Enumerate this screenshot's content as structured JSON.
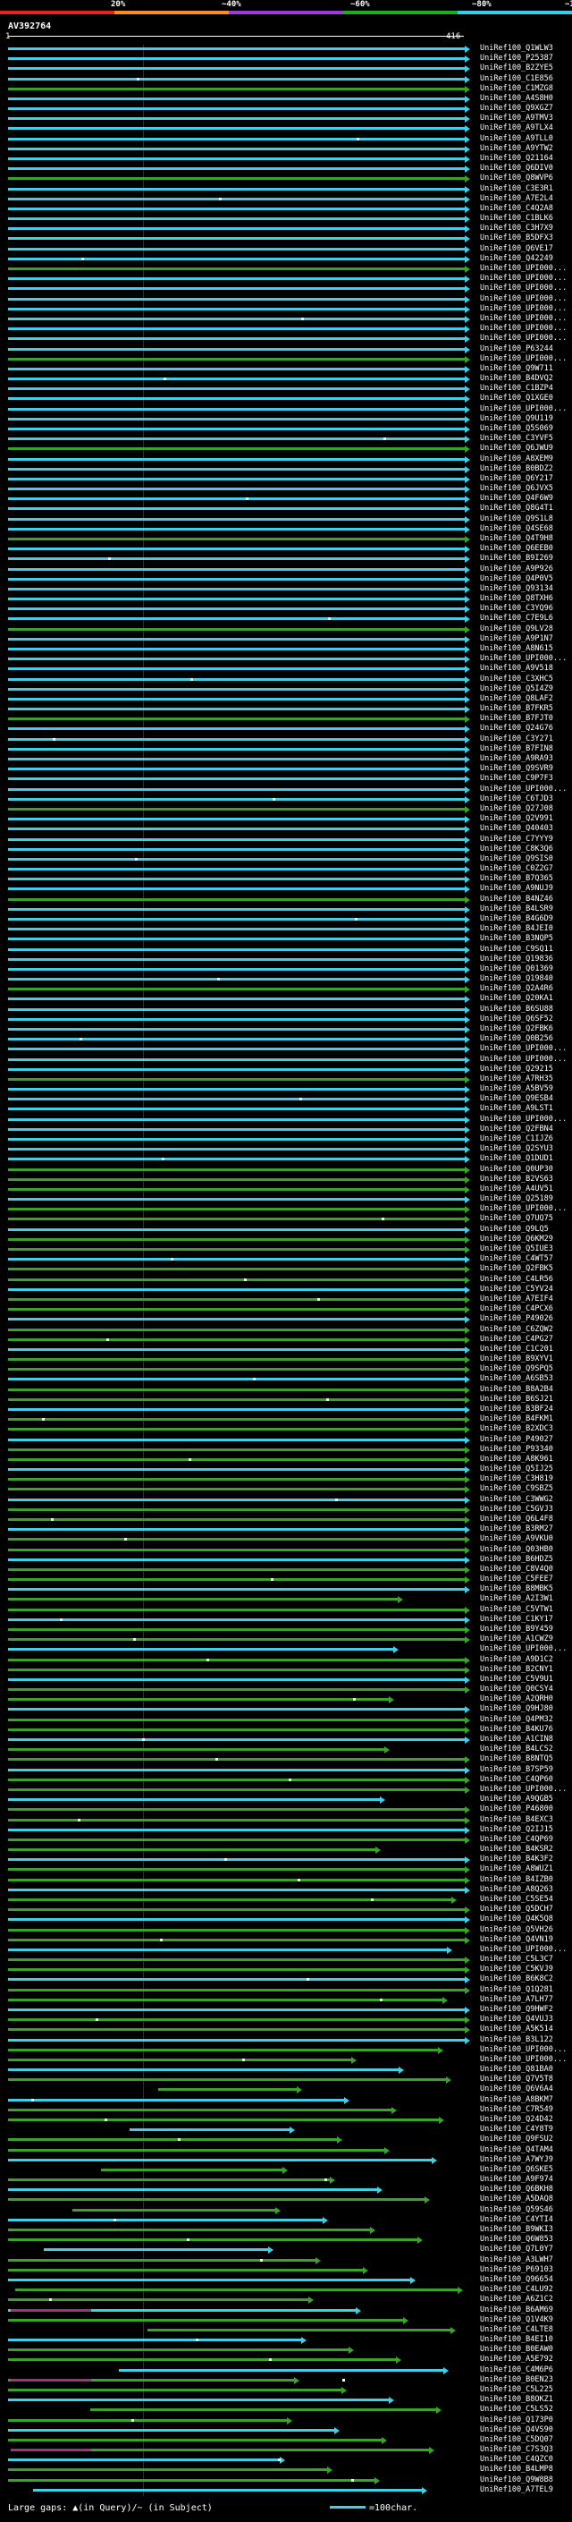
{
  "identity_scale": {
    "labels": [
      "20%",
      "~40%",
      "~60%",
      "~80%",
      "~100%"
    ],
    "colors": [
      "#e8202a",
      "#ff8c1a",
      "#9b3bd8",
      "#1faa1f",
      "#2ed0e6"
    ]
  },
  "query": {
    "id": "AV392764",
    "ruler_start": "1",
    "ruler_end": "416"
  },
  "hit_colors": {
    "cyan": "#3fd0e8",
    "green": "#39a32a",
    "purple": "#a5307f"
  },
  "hits": [
    "UniRef100_Q1WLW3",
    "UniRef100_P25387",
    "UniRef100_B2ZYE5",
    "UniRef100_C1E856",
    "UniRef100_C1MZG8",
    "UniRef100_A4S8H0",
    "UniRef100_Q9XGZ7",
    "UniRef100_A9TMV3",
    "UniRef100_A9TLX4",
    "UniRef100_A9TLL0",
    "UniRef100_A9YTW2",
    "UniRef100_Q21164",
    "UniRef100_Q6DIV0",
    "UniRef100_Q8WVP6",
    "UniRef100_C3E3R1",
    "UniRef100_A7E2L4",
    "UniRef100_C4Q2A8",
    "UniRef100_C1BLK6",
    "UniRef100_C3H7X9",
    "UniRef100_B5DFX3",
    "UniRef100_Q6VE17",
    "UniRef100_Q42249",
    "UniRef100_UPI000...",
    "UniRef100_UPI000...",
    "UniRef100_UPI000...",
    "UniRef100_UPI000...",
    "UniRef100_UPI000...",
    "UniRef100_UPI000...",
    "UniRef100_UPI000...",
    "UniRef100_UPI000...",
    "UniRef100_P63244",
    "UniRef100_UPI000...",
    "UniRef100_Q9W711",
    "UniRef100_B4DVQ2",
    "UniRef100_C1BZP4",
    "UniRef100_Q1XGE0",
    "UniRef100_UPI000...",
    "UniRef100_Q9U119",
    "UniRef100_Q5S069",
    "UniRef100_C3YVF5",
    "UniRef100_Q6JWU9",
    "UniRef100_A8XEM9",
    "UniRef100_B0BDZ2",
    "UniRef100_Q6Y217",
    "UniRef100_Q6JVX5",
    "UniRef100_Q4F6W9",
    "UniRef100_Q8G4T1",
    "UniRef100_Q9S1L8",
    "UniRef100_Q4SE68",
    "UniRef100_Q4T9H8",
    "UniRef100_Q6EEB0",
    "UniRef100_B9I269",
    "UniRef100_A9P926",
    "UniRef100_Q4P0V5",
    "UniRef100_Q93134",
    "UniRef100_Q8TXH6",
    "UniRef100_C3YQ96",
    "UniRef100_C7E9L6",
    "UniRef100_Q9LV28",
    "UniRef100_A9P1N7",
    "UniRef100_A8N615",
    "UniRef100_UPI000...",
    "UniRef100_A9V518",
    "UniRef100_C3XHC5",
    "UniRef100_Q5I4Z9",
    "UniRef100_Q8LAF2",
    "UniRef100_B7FKR5",
    "UniRef100_B7FJT0",
    "UniRef100_Q24G76",
    "UniRef100_C3Y271",
    "UniRef100_B7FIN8",
    "UniRef100_A9RA93",
    "UniRef100_Q9SVR9",
    "UniRef100_C9P7F3",
    "UniRef100_UPI000...",
    "UniRef100_C6TJD3",
    "UniRef100_Q27J08",
    "UniRef100_Q2V991",
    "UniRef100_Q40403",
    "UniRef100_C7YYY9",
    "UniRef100_C8K3Q6",
    "UniRef100_Q9SIS0",
    "UniRef100_C0Z2G7",
    "UniRef100_B7Q365",
    "UniRef100_A9NUJ9",
    "UniRef100_B4NZ46",
    "UniRef100_B4LSR9",
    "UniRef100_B4G6D9",
    "UniRef100_B4JEI0",
    "UniRef100_B3NQP5",
    "UniRef100_C9SQ11",
    "UniRef100_Q19836",
    "UniRef100_Q01369",
    "UniRef100_Q19840",
    "UniRef100_Q2A4R6",
    "UniRef100_Q20KA1",
    "UniRef100_B6SU88",
    "UniRef100_Q6SF52",
    "UniRef100_Q2FBK6",
    "UniRef100_Q0B256",
    "UniRef100_UPI000...",
    "UniRef100_UPI000...",
    "UniRef100_Q29215",
    "UniRef100_A7RH35",
    "UniRef100_A5BV59",
    "UniRef100_Q9ESB4",
    "UniRef100_A9LST1",
    "UniRef100_UPI000...",
    "UniRef100_Q2FBN4",
    "UniRef100_C1IJZ6",
    "UniRef100_Q2SYU3",
    "UniRef100_Q1DUD1",
    "UniRef100_Q0UP30",
    "UniRef100_B2VS63",
    "UniRef100_A4UV51",
    "UniRef100_Q25189",
    "UniRef100_UPI000...",
    "UniRef100_Q7UQ75",
    "UniRef100_Q9LQ5",
    "UniRef100_Q6KM29",
    "UniRef100_Q5IUE3",
    "UniRef100_C4WT57",
    "UniRef100_Q2FBK5",
    "UniRef100_C4LR56",
    "UniRef100_C5YV24",
    "UniRef100_A7EIF4",
    "UniRef100_C4PCX6",
    "UniRef100_P49026",
    "UniRef100_C6ZQW2",
    "UniRef100_C4PG27",
    "UniRef100_C1C201",
    "UniRef100_B9XYV1",
    "UniRef100_Q9SPQ5",
    "UniRef100_A6SB53",
    "UniRef100_B8A2B4",
    "UniRef100_B6SJ21",
    "UniRef100_B3BF24",
    "UniRef100_B4FKM1",
    "UniRef100_B2XDC3",
    "UniRef100_P49027",
    "UniRef100_P93340",
    "UniRef100_A8K961",
    "UniRef100_Q5IJ25",
    "UniRef100_C3H819",
    "UniRef100_C9SBZ5",
    "UniRef100_C3WWG2",
    "UniRef100_C5GVJ3",
    "UniRef100_Q6L4F8",
    "UniRef100_B3RM27",
    "UniRef100_A9VKU0",
    "UniRef100_Q03HB0",
    "UniRef100_B6HDZ5",
    "UniRef100_C8V4Q0",
    "UniRef100_C5FEE7",
    "UniRef100_B8MBK5",
    "UniRef100_A2I3W1",
    "UniRef100_C5VTW1",
    "UniRef100_C1KY17",
    "UniRef100_B9Y459",
    "UniRef100_A1CWZ9",
    "UniRef100_UPI000...",
    "UniRef100_A9D1C2",
    "UniRef100_B2CNY1",
    "UniRef100_C5V9U1",
    "UniRef100_Q0CSY4",
    "UniRef100_A2QRH0",
    "UniRef100_Q9HJ80",
    "UniRef100_Q4PM32",
    "UniRef100_B4KU76",
    "UniRef100_A1CIN8",
    "UniRef100_B4LCS2",
    "UniRef100_B8NTQ5",
    "UniRef100_B7SP59",
    "UniRef100_C4QP60",
    "UniRef100_UPI000...",
    "UniRef100_A9QGB5",
    "UniRef100_P46800",
    "UniRef100_B4EXC3",
    "UniRef100_Q2IJ15",
    "UniRef100_C4QP69",
    "UniRef100_B4KSR2",
    "UniRef100_B4K3F2",
    "UniRef100_A8WUZ1",
    "UniRef100_B4IZB0",
    "UniRef100_A8Q263",
    "UniRef100_C5SE54",
    "UniRef100_Q5DCH7",
    "UniRef100_Q4K5Q8",
    "UniRef100_Q5VH26",
    "UniRef100_Q4VN19",
    "UniRef100_UPI000...",
    "UniRef100_C5L3C7",
    "UniRef100_C5KVJ9",
    "UniRef100_B6K8C2",
    "UniRef100_Q1Q281",
    "UniRef100_A7LH77",
    "UniRef100_Q9HWF2",
    "UniRef100_Q4VUJ3",
    "UniRef100_A5K514",
    "UniRef100_B3L122",
    "UniRef100_UPI000...",
    "UniRef100_UPI000...",
    "UniRef100_Q81BA0",
    "UniRef100_Q7V5T8",
    "UniRef100_Q6V6A4",
    "UniRef100_A8BKM7",
    "UniRef100_C7R549",
    "UniRef100_Q24D42",
    "UniRef100_C4Y8T9",
    "UniRef100_Q9FSU2",
    "UniRef100_Q4TAM4",
    "UniRef100_A7WYJ9",
    "UniRef100_Q6SKE5",
    "UniRef100_A9F974",
    "UniRef100_Q6BKH8",
    "UniRef100_A5DAQ8",
    "UniRef100_Q59S46",
    "UniRef100_C4YTI4",
    "UniRef100_B9WKI3",
    "UniRef100_Q6W853",
    "UniRef100_Q7L0Y7",
    "UniRef100_A3LWH7",
    "UniRef100_P69103",
    "UniRef100_Q96654",
    "UniRef100_C4LU92",
    "UniRef100_A6Z1C2",
    "UniRef100_B6AM69",
    "UniRef100_Q1V4K9",
    "UniRef100_C4LTE8",
    "UniRef100_B4EI10",
    "UniRef100_B0EAW0",
    "UniRef100_A5E792",
    "UniRef100_C4M6P6",
    "UniRef100_B0EN23",
    "UniRef100_C5L225",
    "UniRef100_B8OKZ1",
    "UniRef100_C5LS52",
    "UniRef100_Q173P0",
    "UniRef100_Q4VS90",
    "UniRef100_C5DQ07",
    "UniRef100_C7S3Q3",
    "UniRef100_C4QZC0",
    "UniRef100_B4LMP8",
    "UniRef100_Q9W8B8",
    "UniRef100_A7TEL9"
  ],
  "footer": {
    "large_gaps_text": "Large gaps: ▲(in Query)/~ (in Subject)",
    "legend_text": "=100char."
  }
}
